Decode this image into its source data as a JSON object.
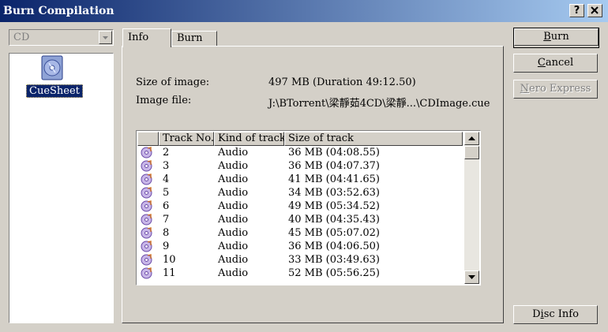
{
  "window": {
    "title": "Burn Compilation",
    "help_button": "?",
    "close_button": "X"
  },
  "left": {
    "dropdown_value": "CD",
    "item_label": "CueSheet"
  },
  "tabs": [
    {
      "label": "Info",
      "active": true
    },
    {
      "label": "Burn",
      "active": false
    }
  ],
  "info": {
    "size_label": "Size of image:",
    "size_value": "497 MB (Duration 49:12.50)",
    "file_label": "Image file:",
    "file_value": "J:\\BTorrent\\梁靜茹4CD\\梁靜...\\CDImage.cue"
  },
  "table": {
    "columns": [
      "",
      "Track No.",
      "Kind of track",
      "Size of track"
    ],
    "rows": [
      {
        "track": "2",
        "kind": "Audio",
        "size": "36 MB (04:08.55)"
      },
      {
        "track": "3",
        "kind": "Audio",
        "size": "36 MB (04:07.37)"
      },
      {
        "track": "4",
        "kind": "Audio",
        "size": "41 MB (04:41.65)"
      },
      {
        "track": "5",
        "kind": "Audio",
        "size": "34 MB (03:52.63)"
      },
      {
        "track": "6",
        "kind": "Audio",
        "size": "49 MB (05:34.52)"
      },
      {
        "track": "7",
        "kind": "Audio",
        "size": "40 MB (04:35.43)"
      },
      {
        "track": "8",
        "kind": "Audio",
        "size": "45 MB (05:07.02)"
      },
      {
        "track": "9",
        "kind": "Audio",
        "size": "36 MB (04:06.50)"
      },
      {
        "track": "10",
        "kind": "Audio",
        "size": "33 MB (03:49.63)"
      },
      {
        "track": "11",
        "kind": "Audio",
        "size": "52 MB (05:56.25)"
      }
    ]
  },
  "buttons": {
    "burn": {
      "first": "B",
      "rest": "urn"
    },
    "cancel": {
      "first": "C",
      "rest": "ancel"
    },
    "nero_express": {
      "first": "N",
      "rest": "ero Express",
      "enabled": false
    },
    "disc_info": {
      "pre": "D",
      "mid": "i",
      "post": "sc Info"
    }
  }
}
